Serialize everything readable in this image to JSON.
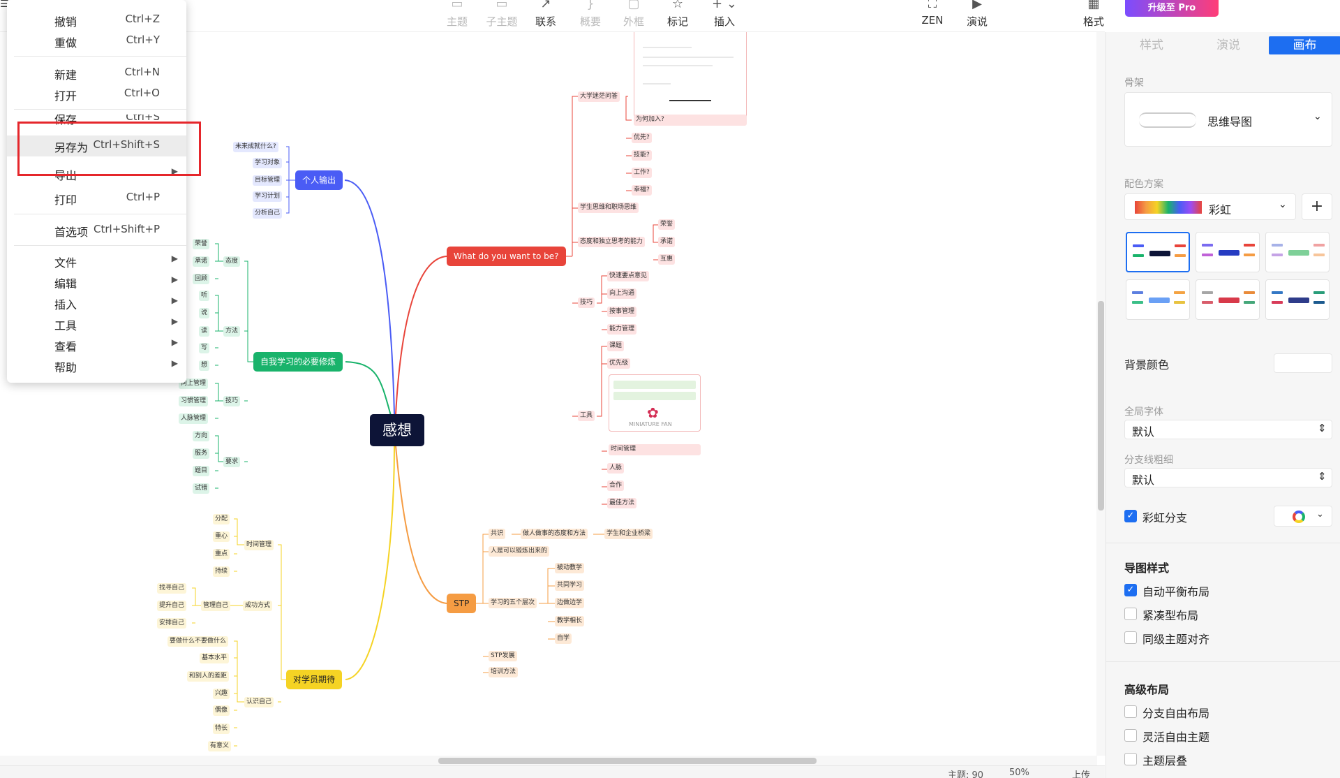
{
  "toolbar": {
    "items": [
      {
        "label": "主题",
        "icon": "topic-icon",
        "disabled": true
      },
      {
        "label": "子主题",
        "icon": "subtopic-icon",
        "disabled": true
      },
      {
        "label": "联系",
        "icon": "relationship-icon",
        "disabled": false
      },
      {
        "label": "概要",
        "icon": "summary-icon",
        "disabled": true
      },
      {
        "label": "外框",
        "icon": "boundary-icon",
        "disabled": true
      },
      {
        "label": "标记",
        "icon": "star-icon",
        "disabled": false
      },
      {
        "label": "插入",
        "icon": "plus-icon",
        "disabled": false
      },
      {
        "label": "ZEN",
        "icon": "fullscreen-icon",
        "disabled": false
      },
      {
        "label": "演说",
        "icon": "presentation-icon",
        "disabled": false
      },
      {
        "label": "格式",
        "icon": "format-icon",
        "disabled": false
      }
    ],
    "pro_label": "升级至 Pro"
  },
  "file_menu": {
    "title": "感想",
    "items": [
      {
        "label": "撤销",
        "shortcut": "Ctrl+Z"
      },
      {
        "label": "重做",
        "shortcut": "Ctrl+Y"
      },
      {
        "label": "新建",
        "shortcut": "Ctrl+N"
      },
      {
        "label": "打开",
        "shortcut": "Ctrl+O"
      },
      {
        "label": "保存",
        "shortcut": "Ctrl+S"
      },
      {
        "label": "另存为",
        "shortcut": "Ctrl+Shift+S",
        "highlighted": true
      },
      {
        "label": "导出",
        "submenu": true
      },
      {
        "label": "打印",
        "shortcut": "Ctrl+P"
      },
      {
        "label": "首选项",
        "shortcut": "Ctrl+Shift+P"
      },
      {
        "label": "文件",
        "submenu": true
      },
      {
        "label": "编辑",
        "submenu": true
      },
      {
        "label": "插入",
        "submenu": true
      },
      {
        "label": "工具",
        "submenu": true
      },
      {
        "label": "查看",
        "submenu": true
      },
      {
        "label": "帮助",
        "submenu": true
      }
    ]
  },
  "mindmap": {
    "root": "感想",
    "branches": {
      "personal_output": {
        "label": "个人输出",
        "color": "#4a5cf5",
        "children": [
          "未来成就什么?",
          "学习对象",
          "目标管理",
          "学习计划",
          "分析自己"
        ]
      },
      "self_learning": {
        "label": "自我学习的必要修炼",
        "color": "#19b36b",
        "groups": [
          {
            "label": "态度",
            "children": [
              "荣誉",
              "承诺",
              "回顾"
            ]
          },
          {
            "label": "方法",
            "children": [
              "听",
              "说",
              "读",
              "写",
              "想"
            ]
          },
          {
            "label": "技巧",
            "children": [
              "向上管理",
              "习惯管理",
              "人脉管理"
            ]
          },
          {
            "label": "要求",
            "children": [
              "方向",
              "服务",
              "题目",
              "试错"
            ]
          }
        ]
      },
      "expectation": {
        "label": "对学员期待",
        "color": "#f5d324",
        "groups": [
          {
            "label": "时间管理",
            "children": [
              "分配",
              "重心",
              "重点",
              "持续"
            ]
          },
          {
            "label": "成功方式",
            "sub": "管理自己",
            "children": [
              "找寻自己",
              "提升自己",
              "安排自己"
            ]
          },
          {
            "label": "认识自己",
            "children": [
              "要做什么不要做什么",
              "基本水平",
              "和别人的差距",
              "兴趣",
              "偶像",
              "特长",
              "有意义"
            ]
          }
        ]
      },
      "what_do_you_want": {
        "label": "What do you want to be?",
        "color": "#e8443a",
        "groups": [
          {
            "label": "大学迷茫问答",
            "children": [
              "为何加入?",
              "优先?",
              "技能?",
              "工作?",
              "幸福?"
            ]
          },
          {
            "label": "学生思维和职场思维",
            "children": []
          },
          {
            "label": "态度和独立思考的能力",
            "children": [
              "荣誉",
              "承诺",
              "互惠"
            ]
          },
          {
            "label": "技巧",
            "children": [
              "快速要点意见",
              "向上沟通",
              "按事管理",
              "能力管理"
            ]
          },
          {
            "label": "工具",
            "children": [
              "课题",
              "优先级",
              "时间管理",
              "人脉",
              "合作",
              "最佳方法"
            ]
          }
        ],
        "image_caption": "MINIATURE FAN"
      },
      "stp": {
        "label": "STP",
        "color": "#f59c43",
        "children": [
          {
            "label": "共识",
            "chain": [
              "做人做事的态度和方法",
              "学生和企业桥梁"
            ]
          },
          {
            "label": "人是可以锻炼出来的"
          },
          {
            "label": "学习的五个层次",
            "children": [
              "被动教学",
              "共同学习",
              "边做边学",
              "教学相长",
              "自学"
            ]
          },
          {
            "label": "STP发展"
          },
          {
            "label": "培训方法"
          }
        ]
      }
    }
  },
  "panel": {
    "tabs": [
      "样式",
      "演说",
      "画布"
    ],
    "active_tab": "画布",
    "skeleton_label": "骨架",
    "skeleton_value": "思维导图",
    "color_scheme_label": "配色方案",
    "color_scheme_value": "彩虹",
    "add_label": "+",
    "bg_color_label": "背景颜色",
    "global_font_label": "全局字体",
    "global_font_value": "默认",
    "branch_width_label": "分支线粗细",
    "branch_width_value": "默认",
    "rainbow_branch_label": "彩虹分支",
    "map_style_title": "导图样式",
    "map_style_options": [
      {
        "label": "自动平衡布局",
        "checked": true
      },
      {
        "label": "紧凑型布局",
        "checked": false
      },
      {
        "label": "同级主题对齐",
        "checked": false
      }
    ],
    "advanced_title": "高级布局",
    "advanced_options": [
      {
        "label": "分支自由布局",
        "checked": false
      },
      {
        "label": "灵活自由主题",
        "checked": false
      },
      {
        "label": "主题层叠",
        "checked": false
      }
    ]
  },
  "status": {
    "topics": "主题: 90",
    "zoom": "50%",
    "upload": "上传"
  },
  "colors": {
    "accent": "#1d6ef1",
    "root": "#0d1437",
    "highlight_box": "#e5262b"
  }
}
